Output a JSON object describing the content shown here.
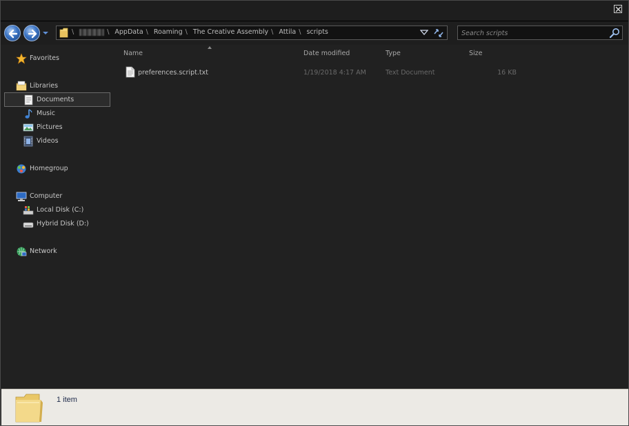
{
  "window": {
    "close_label": "Close"
  },
  "navigation": {
    "back_icon": "back-arrow-icon",
    "forward_icon": "forward-arrow-icon",
    "history_icon": "chevron-down-icon"
  },
  "address_bar": {
    "breadcrumb": [
      "AppData",
      "Roaming",
      "The Creative Assembly",
      "Attila",
      "scripts"
    ],
    "separator": "\\",
    "user_folder_obscured": true
  },
  "search": {
    "placeholder": "Search scripts"
  },
  "sidebar": {
    "favorites": "Favorites",
    "libraries": "Libraries",
    "library_items": [
      "Documents",
      "Music",
      "Pictures",
      "Videos"
    ],
    "selected": "Documents",
    "homegroup": "Homegroup",
    "computer": "Computer",
    "drives": [
      "Local Disk (C:)",
      "Hybrid Disk (D:)"
    ],
    "network": "Network"
  },
  "file_list": {
    "columns": [
      "Name",
      "Date modified",
      "Type",
      "Size"
    ],
    "sort_column": "Name",
    "rows": [
      {
        "name": "preferences.script.txt",
        "date": "1/19/2018 4:17 AM",
        "type": "Text Document",
        "size": "16 KB"
      }
    ]
  },
  "statusbar": {
    "count_text": "1 item"
  },
  "colors": {
    "background": "#212121",
    "statusbar": "#eceae5",
    "accent": "#3b74c4"
  }
}
